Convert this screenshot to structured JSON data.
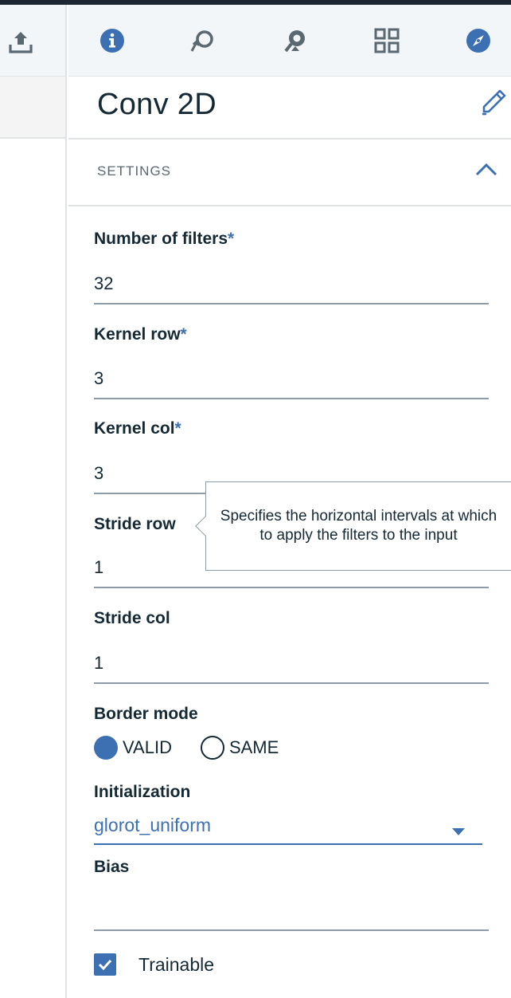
{
  "panel": {
    "title": "Conv 2D",
    "section_label": "SETTINGS"
  },
  "toolbar": {
    "left_icons": [
      "upload-icon"
    ],
    "icons": [
      "info-icon",
      "rotate-left-icon",
      "rotate-right-icon",
      "grid-icon",
      "compass-icon"
    ]
  },
  "fields": {
    "filters": {
      "label": "Number of filters",
      "required_mark": "*",
      "value": "32"
    },
    "kernel_row": {
      "label": "Kernel row",
      "required_mark": "*",
      "value": "3"
    },
    "kernel_col": {
      "label": "Kernel col",
      "required_mark": "*",
      "value": "3"
    },
    "stride_row": {
      "label": "Stride row",
      "value": "1"
    },
    "stride_col": {
      "label": "Stride col",
      "value": "1"
    },
    "border_mode": {
      "label": "Border mode",
      "options": [
        "VALID",
        "SAME"
      ],
      "selected": "VALID"
    },
    "initialization": {
      "label": "Initialization",
      "value": "glorot_uniform"
    },
    "bias": {
      "label": "Bias",
      "value": ""
    },
    "trainable": {
      "label": "Trainable",
      "checked": true
    }
  },
  "tooltip": {
    "text": "Specifies the horizontal intervals at which to apply the filters to the input"
  },
  "colors": {
    "accent": "#3d70b2",
    "text": "#152935",
    "toolbar_bg": "#f3f6f9",
    "divider": "#dfe3e6",
    "topbar": "#1d2731"
  }
}
